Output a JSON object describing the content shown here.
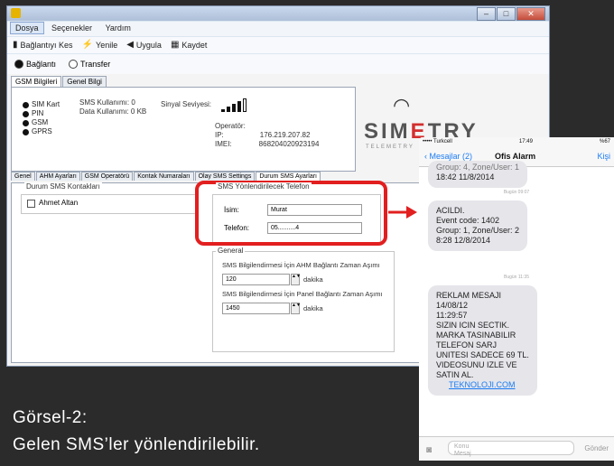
{
  "window": {
    "close_glyph": "✕",
    "min_glyph": "–",
    "max_glyph": "□"
  },
  "menu": [
    "Dosya",
    "Seçenekler",
    "Yardım"
  ],
  "toolbar": {
    "disconnect": "Bağlantıyı Kes",
    "refresh": "Yenile",
    "apply": "Uygula",
    "save": "Kaydet"
  },
  "mode": {
    "connected": "Bağlantı",
    "transfer": "Transfer"
  },
  "top_tabs": [
    "GSM Bilgileri",
    "Genel Bilgi"
  ],
  "status": [
    "SIM Kart",
    "PIN",
    "GSM",
    "GPRS"
  ],
  "sms": {
    "used": "SMS Kullanımı: 0",
    "data": "Data Kullanımı: 0 KB"
  },
  "signal": {
    "label": "Sinyal Seviyesi:",
    "bars": 4
  },
  "operator": {
    "l1": "Operatör:",
    "l2": "IP:",
    "l3": "IMEI:",
    "ip": "176.219.207.82",
    "imei": "868204020923194"
  },
  "logo": {
    "name_pre": "SIM",
    "name_acc": "E",
    "name_post": "TRY",
    "sub": "TELEMETRY"
  },
  "tabs": [
    "Genel",
    "AHM Ayarları",
    "GSM Operatörü",
    "Kontak Numaraları",
    "Olay SMS Settings",
    "Durum SMS Ayarları"
  ],
  "contacts": {
    "title": "Durum SMS Kontakları",
    "item": "Ahmet Altan"
  },
  "forward": {
    "title": "SMS Yönlendirilecek Telefon",
    "name_label": "İsim:",
    "name_value": "Murat",
    "phone_label": "Telefon:",
    "phone_value": "05..........4"
  },
  "general": {
    "title": "General",
    "ahm_label": "SMS Bilgilendirmesi İçin AHM Bağlantı Zaman Aşımı",
    "ahm_value": "120",
    "panel_label": "SMS Bilgilendirmesi İçin Panel Bağlantı Zaman Aşımı",
    "panel_value": "1450",
    "unit": "dakika"
  },
  "caption": {
    "line1": "Görsel-2:",
    "line2": "Gelen SMS’ler yönlendirilebilir."
  },
  "phone": {
    "carrier": "••••• Turkcell ",
    "time": "17:49",
    "battery": "%67",
    "back": "Mesajlar (2)",
    "contact": "Ofis Alarm",
    "right": "Kişi",
    "msg0": [
      "Group: 4, Zone/User: 1",
      "18:42 11/8/2014"
    ],
    "ts1": "Bugün 09:07",
    "msg1": [
      "ACILDI.",
      "Event code: 1402",
      "Group: 1, Zone/User: 2",
      "8:28 12/8/2014"
    ],
    "ts2": "Bugün 11:35",
    "msg2": [
      "REKLAM MESAJI",
      "14/08/12",
      "11:29:57",
      "SIZIN ICIN SECTIK.",
      "MARKA  TASINABILIR",
      "TELEFON SARJ",
      "UNITESI SADECE 69 TL.",
      "VIDEOSUNU IZLE VE",
      "SATIN AL."
    ],
    "link": "TEKNOLOJI.COM",
    "input_placeholder": "Konu",
    "input_placeholder2": "Mesaj",
    "send": "Gönder"
  }
}
